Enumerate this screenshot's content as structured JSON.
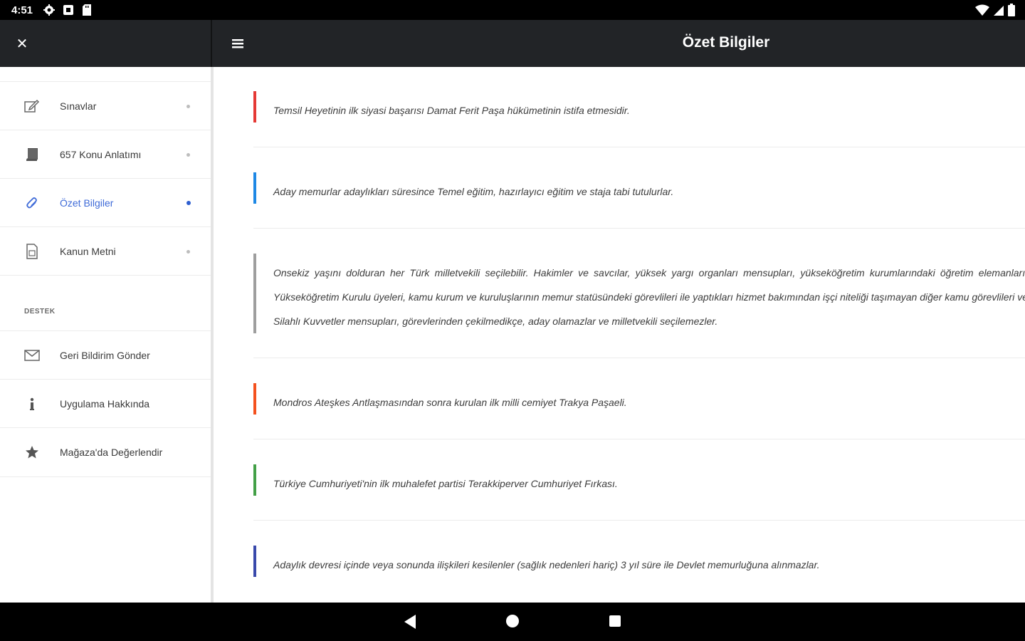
{
  "status_bar": {
    "time": "4:51",
    "left_icons": [
      "gear-icon",
      "notification-icon",
      "sd-card-icon"
    ],
    "right_icons": [
      "wifi-icon",
      "signal-icon",
      "battery-icon"
    ]
  },
  "toolbar": {
    "close_icon": "close-icon",
    "menu_icon": "hamburger-menu-icon",
    "title": "Özet Bilgiler",
    "background_color": "#222427"
  },
  "sidebar": {
    "items": [
      {
        "label": "Sınavlar",
        "icon": "edit-icon",
        "active": false
      },
      {
        "label": "657 Konu Anlatımı",
        "icon": "book-icon",
        "active": false
      },
      {
        "label": "Özet Bilgiler",
        "icon": "paperclip-icon",
        "active": true
      },
      {
        "label": "Kanun Metni",
        "icon": "document-icon",
        "active": false
      }
    ],
    "section_title": "DESTEK",
    "support_items": [
      {
        "label": "Geri Bildirim Gönder",
        "icon": "mail-icon"
      },
      {
        "label": "Uygulama Hakkında",
        "icon": "info-icon"
      },
      {
        "label": "Mağaza'da Değerlendir",
        "icon": "star-icon"
      }
    ],
    "active_color": "#3f6bd8"
  },
  "summaries": [
    {
      "text": "Temsil Heyetinin ilk siyasi başarısı Damat Ferit Paşa hükümetinin istifa etmesidir.",
      "color": "#e53935"
    },
    {
      "text": "Aday memurlar adaylıkları süresince Temel eğitim, hazırlayıcı eğitim ve staja tabi tutulurlar.",
      "color": "#1e88e5"
    },
    {
      "text": "Onsekiz yaşını dolduran her Türk milletvekili seçilebilir. Hakimler ve savcılar, yüksek yargı organları mensupları, yükseköğretim kurumlarındaki öğretim elemanları, Yükseköğretim Kurulu üyeleri, kamu kurum ve kuruluşlarının memur statüsündeki görevlileri ile yaptıkları hizmet bakımından işçi niteliği taşımayan diğer kamu görevlileri ve Silahlı Kuvvetler mensupları, görevlerinden çekilmedikçe, aday olamazlar ve milletvekili seçilemezler.",
      "color": "#9e9e9e"
    },
    {
      "text": "Mondros Ateşkes Antlaşmasından sonra kurulan ilk milli cemiyet Trakya Paşaeli.",
      "color": "#f4511e"
    },
    {
      "text": "Türkiye Cumhuriyeti'nin ilk muhalefet partisi Terakkiperver Cumhuriyet Fırkası.",
      "color": "#43a047"
    },
    {
      "text": "Adaylık devresi içinde veya sonunda ilişkileri kesilenler (sağlık nedenleri hariç) 3 yıl süre ile Devlet memurluğuna alınmazlar.",
      "color": "#3949ab"
    }
  ],
  "system_nav": [
    "back-icon",
    "home-icon",
    "recents-icon"
  ]
}
